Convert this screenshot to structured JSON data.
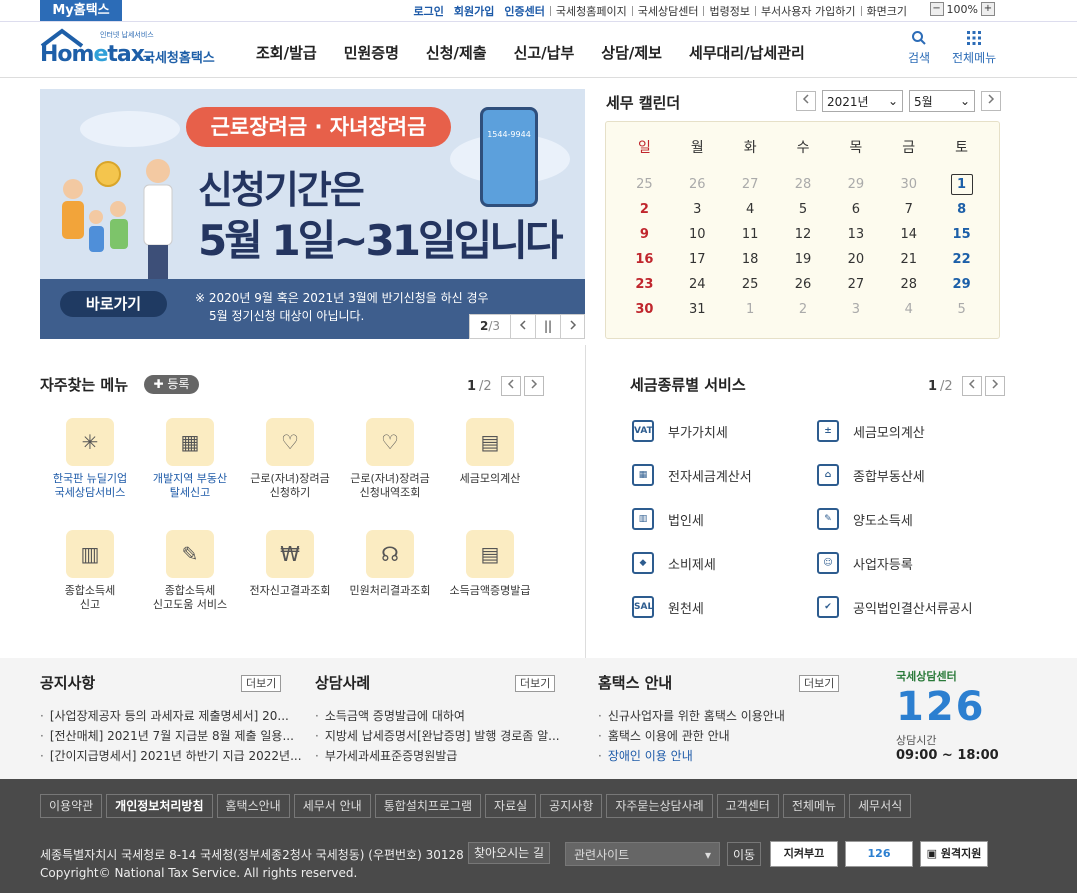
{
  "util": {
    "myhome": "My홈택스",
    "links": [
      "로그인",
      "회원가입",
      "인증센터",
      "국세청홈페이지",
      "국세상담센터",
      "법령정보",
      "부서사용자 가입하기",
      "화면크기"
    ],
    "zoom": "100%",
    "zoom_minus": "−",
    "zoom_plus": "+"
  },
  "logo": {
    "home": "Hom",
    "e": "e",
    "tax": "tax.",
    "sub": "인터넷 납세서비스",
    "kr": "국세청홈택스"
  },
  "gnb": [
    "조회/발급",
    "민원증명",
    "신청/제출",
    "신고/납부",
    "상담/제보",
    "세무대리/납세관리"
  ],
  "header": {
    "search": "검색",
    "allmenu": "전체메뉴"
  },
  "banner": {
    "tag": "근로장려금 · 자녀장려금",
    "line1": "신청기간은",
    "line2": "5월 1일~31일입니다",
    "phone": "1544-9944",
    "go": "바로가기",
    "note1": "※ 2020년 9월 혹은 2021년 3월에 반기신청을 하신 경우",
    "note2": "5월 정기신청 대상이 아닙니다.",
    "page_cur": "2",
    "page_total": "/3",
    "pause": "||"
  },
  "calendar": {
    "title": "세무 캘린더",
    "year": "2021년",
    "month": "5월",
    "weekdays": [
      "일",
      "월",
      "화",
      "수",
      "목",
      "금",
      "토"
    ],
    "weeks": [
      [
        "25",
        "26",
        "27",
        "28",
        "29",
        "30",
        "1"
      ],
      [
        "2",
        "3",
        "4",
        "5",
        "6",
        "7",
        "8"
      ],
      [
        "9",
        "10",
        "11",
        "12",
        "13",
        "14",
        "15"
      ],
      [
        "16",
        "17",
        "18",
        "19",
        "20",
        "21",
        "22"
      ],
      [
        "23",
        "24",
        "25",
        "26",
        "27",
        "28",
        "29"
      ],
      [
        "30",
        "31",
        "1",
        "2",
        "3",
        "4",
        "5"
      ]
    ]
  },
  "favorites": {
    "title": "자주찾는 메뉴",
    "register": "등록",
    "page_cur": "1",
    "page_total": "/2",
    "items": [
      [
        "한국판 뉴딜기업",
        "국세상담서비스"
      ],
      [
        "개발지역 부동산",
        "탈세신고"
      ],
      [
        "근로(자녀)장려금",
        "신청하기"
      ],
      [
        "근로(자녀)장려금",
        "신청내역조회"
      ],
      [
        "세금모의계산",
        ""
      ],
      [
        "종합소득세",
        "신고"
      ],
      [
        "종합소득세",
        "신고도움 서비스"
      ],
      [
        "전자신고결과조회",
        ""
      ],
      [
        "민원처리결과조회",
        ""
      ],
      [
        "소득금액증명발급",
        ""
      ]
    ]
  },
  "taxservice": {
    "title": "세금종류별 서비스",
    "page_cur": "1",
    "page_total": "/2",
    "items": [
      "부가가치세",
      "세금모의계산",
      "전자세금계산서",
      "종합부동산세",
      "법인세",
      "양도소득세",
      "소비제세",
      "사업자등록",
      "원천세",
      "공익법인결산서류공시"
    ],
    "vat_label": "VAT",
    "sal_label": "SAL"
  },
  "notice": {
    "title": "공지사항",
    "more": "더보기",
    "items": [
      "[사업장제공자 등의 과세자료 제출명세서] 20...",
      "[전산매체] 2021년 7월 지급분 8월 제출 일용...",
      "[간이지급명세서] 2021년 하반기 지급 2022년..."
    ]
  },
  "counsel": {
    "title": "상담사례",
    "more": "더보기",
    "items": [
      "소득금액 증명발급에 대하여",
      "지방세 납세증명서[완납증명] 발행 경로좀 알...",
      "부가세과세표준증명원발급"
    ]
  },
  "guide": {
    "title": "홈택스 안내",
    "more": "더보기",
    "items": [
      "신규사업자를 위한 홈택스 이용안내",
      "홈택스 이용에 관한 안내",
      "장애인 이용 안내"
    ]
  },
  "center": {
    "label": "국세상담센터",
    "num": "126",
    "hours_label": "상담시간",
    "hours": "09:00 ~ 18:00"
  },
  "footer": {
    "menu": [
      "이용약관",
      "개인정보처리방침",
      "홈택스안내",
      "세무서 안내",
      "통합설치프로그램",
      "자료실",
      "공지사항",
      "자주묻는상담사례",
      "고객센터",
      "전체메뉴",
      "세무서식"
    ],
    "address": "세종특별자치시 국세청로 8-14 국세청(정부세종2청사 국세청동) (우편번호) 30128",
    "map": "찾아오시는 길",
    "copyright": "Copyright© National Tax Service. All rights reserved.",
    "related": "관련사이트",
    "go": "이동",
    "b1": "지켜부끄",
    "b2": "126",
    "b3": "원격지원"
  }
}
